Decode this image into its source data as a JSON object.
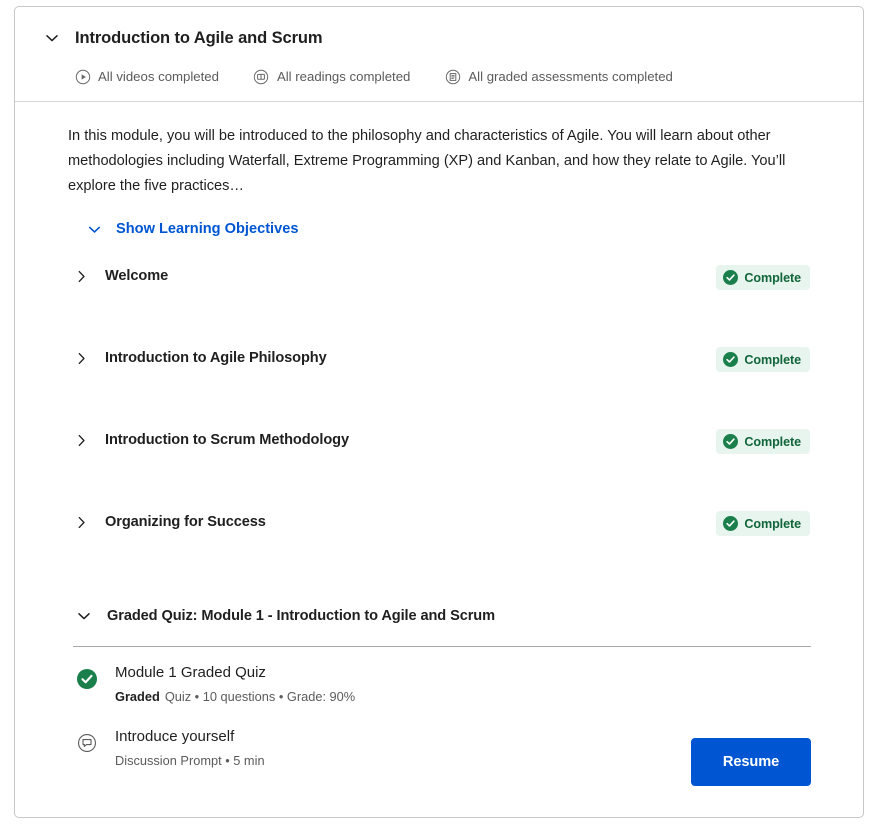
{
  "module": {
    "title": "Introduction to Agile and Scrum",
    "collapse_icon": "chevron-down-icon",
    "meta": [
      {
        "icon": "play-circle-icon",
        "label": "All videos completed"
      },
      {
        "icon": "book-circle-icon",
        "label": "All readings completed"
      },
      {
        "icon": "assessment-circle-icon",
        "label": "All graded assessments completed"
      }
    ],
    "description": "In this module, you will be introduced to the philosophy and characteristics of Agile. You will learn about other methodologies including Waterfall, Extreme Programming (XP) and Kanban, and how they relate to Agile. You’ll explore the five practices…",
    "objectives_toggle": "Show Learning Objectives"
  },
  "lessons": [
    {
      "title": "Welcome",
      "status": "Complete",
      "chevron": "chevron-right-icon"
    },
    {
      "title": "Introduction to Agile Philosophy",
      "status": "Complete",
      "chevron": "chevron-right-icon"
    },
    {
      "title": "Introduction to Scrum Methodology",
      "status": "Complete",
      "chevron": "chevron-right-icon"
    },
    {
      "title": "Organizing for Success",
      "status": "Complete",
      "chevron": "chevron-right-icon"
    }
  ],
  "graded_section": {
    "title": "Graded Quiz: Module 1 - Introduction to Agile and Scrum",
    "chevron": "chevron-down-icon",
    "items": [
      {
        "icon": "check-circle-filled-icon",
        "title": "Module 1 Graded Quiz",
        "tag": "Graded",
        "meta": "Quiz • 10 questions • Grade: 90%"
      },
      {
        "icon": "discussion-prompt-icon",
        "title": "Introduce yourself",
        "tag": "",
        "meta": "Discussion Prompt • 5 min"
      }
    ]
  },
  "actions": {
    "resume_label": "Resume"
  },
  "colors": {
    "accent_blue": "#0056d2",
    "complete_green": "#11653a",
    "complete_bg": "#e8f5ee",
    "check_green": "#1a7f4b",
    "card_border": "#c7c7c7"
  }
}
